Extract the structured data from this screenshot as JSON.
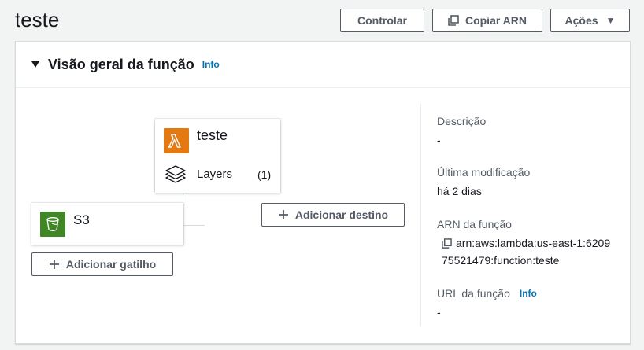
{
  "header": {
    "title": "teste",
    "buttons": {
      "throttle": "Controlar",
      "copy_arn": "Copiar ARN",
      "actions": "Ações"
    }
  },
  "overview": {
    "title": "Visão geral da função",
    "info": "Info",
    "function_card": {
      "name": "teste",
      "layers_label": "Layers",
      "layers_count": "(1)"
    },
    "trigger_card": {
      "name": "S3"
    },
    "add_trigger": "Adicionar gatilho",
    "add_destination": "Adicionar destino",
    "details": {
      "description_label": "Descrição",
      "description_value": "-",
      "last_modified_label": "Última modificação",
      "last_modified_value": "há 2 dias",
      "arn_label": "ARN da função",
      "arn_line1": "arn:aws:lambda:us-east-1:6209",
      "arn_line2": "75521479:function:teste",
      "url_label": "URL da função",
      "url_info": "Info",
      "url_value": "-"
    }
  },
  "colors": {
    "lambda_orange": "#e47911",
    "s3_green": "#3f8624",
    "link_blue": "#0073bb"
  },
  "icons": [
    "copy-icon",
    "caret-down-icon",
    "lambda-icon",
    "layers-icon",
    "s3-bucket-icon",
    "plus-icon"
  ]
}
